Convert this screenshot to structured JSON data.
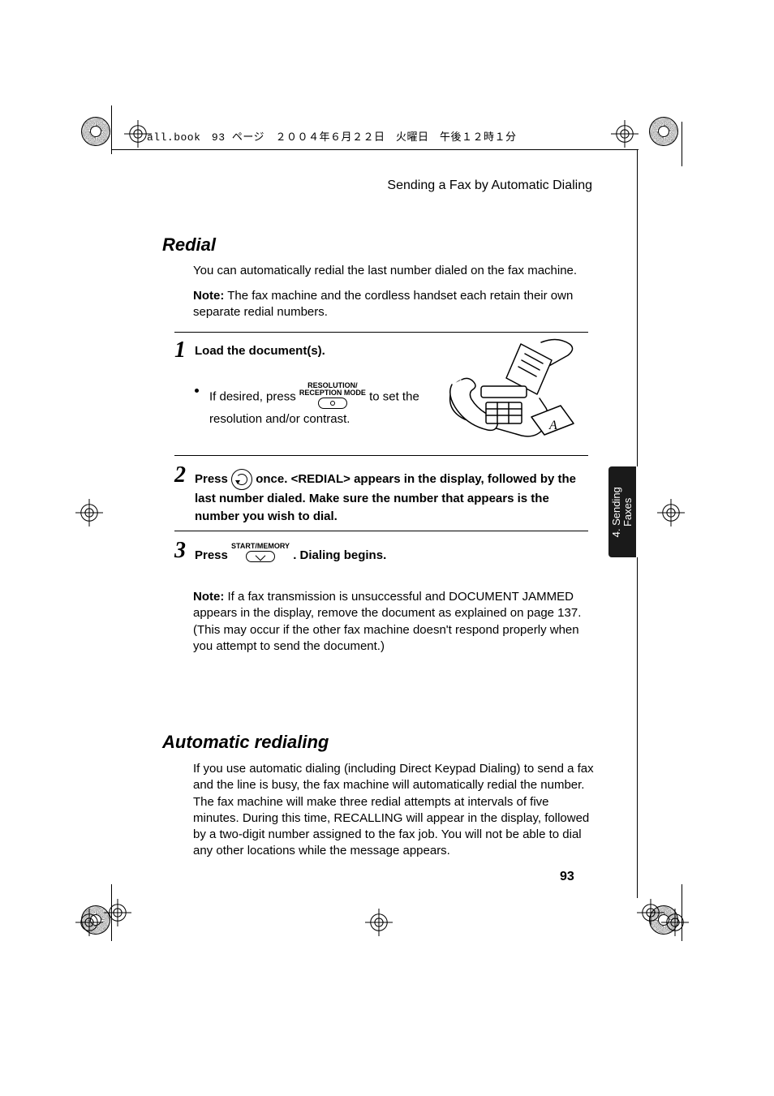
{
  "meta_header": "all.book　93 ページ　２００４年６月２２日　火曜日　午後１２時１分",
  "running_head": "Sending a Fax by Automatic Dialing",
  "section1_title": "Redial",
  "section1_intro1": "You can automatically redial the last number dialed on the fax machine.",
  "section1_intro2_prefix": "Note:",
  "section1_intro2_body": " The fax machine and the cordless handset each retain their own separate redial numbers.",
  "step1_num": "1",
  "step1_head": "Load the document(s).",
  "step1_bullet_pre": "If desired, press ",
  "step1_key_label1": "RESOLUTION/",
  "step1_key_label2": "RECEPTION MODE",
  "step1_bullet_post": " to set the resolution and/or contrast.",
  "step2_num": "2",
  "step2_pre": "Press ",
  "step2_post": " once. <REDIAL> appears in the display, followed by the last number dialed. Make sure the number that appears is the number you wish to dial.",
  "step3_num": "3",
  "step3_pre": "Press ",
  "step3_key_label": "START/MEMORY",
  "step3_post": " . Dialing begins.",
  "note_after_prefix": "Note:",
  "note_after_body": " If a fax transmission is unsuccessful and DOCUMENT JAMMED appears in the display, remove the document as explained on page 137.  (This may occur if the other fax machine doesn't respond properly when you attempt to send the document.)",
  "section2_title": "Automatic redialing",
  "section2_body": "If you use automatic dialing (including Direct Keypad Dialing) to send a fax and the line is busy, the fax machine will automatically redial the number. The fax machine will make three redial attempts at intervals of five minutes. During this time, RECALLING will appear in the display, followed by a two-digit number assigned to the fax job. You will not be able to dial any other locations while the message appears.",
  "page_number": "93",
  "side_tab_line1": "4. Sending",
  "side_tab_line2": "Faxes"
}
